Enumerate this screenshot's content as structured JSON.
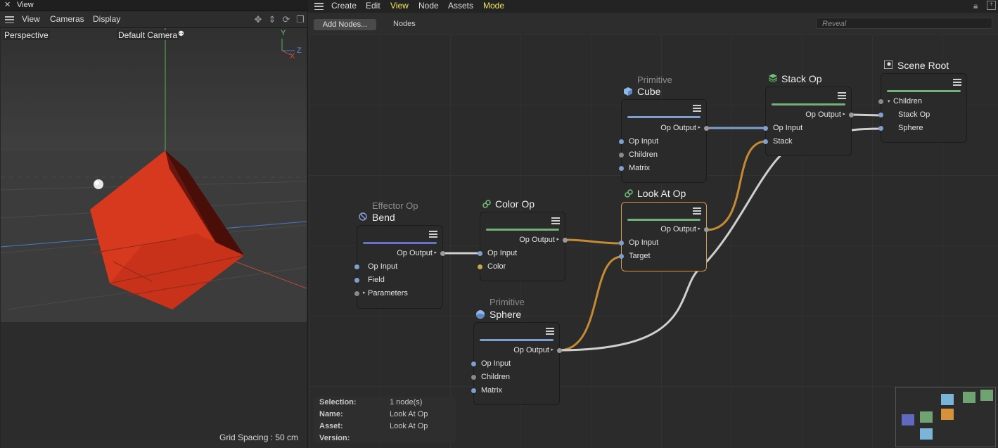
{
  "viewport": {
    "title": "View",
    "close_glyph": "✕",
    "menus": [
      "View",
      "Cameras",
      "Display"
    ],
    "projection": "Perspective",
    "camera": "Default Camera",
    "axis_y": "Y",
    "axis_z": "Z",
    "axis_x": "X",
    "grid_spacing": "Grid Spacing : 50 cm",
    "nav_icons": [
      "move-icon",
      "dolly-icon",
      "rotate-icon",
      "maximize-icon"
    ]
  },
  "editor": {
    "menus": [
      "Create",
      "Edit",
      "View",
      "Node",
      "Assets",
      "Mode"
    ],
    "active_menus": [
      "View",
      "Mode"
    ],
    "add_nodes": "Add Nodes...",
    "nodes_label": "Nodes",
    "reveal_placeholder": "Reveal",
    "nodes": {
      "cube": {
        "subtitle": "Primitive",
        "title": "Cube",
        "output": "Op Output",
        "inputs": [
          "Op Input",
          "Children",
          "Matrix"
        ]
      },
      "stack": {
        "title": "Stack Op",
        "output": "Op Output",
        "inputs": [
          "Op Input",
          "Stack"
        ]
      },
      "scene_root": {
        "title": "Scene Root",
        "inputs": [
          "Children",
          "Stack Op",
          "Sphere"
        ]
      },
      "bend": {
        "subtitle": "Effector Op",
        "title": "Bend",
        "output": "Op Output",
        "inputs": [
          "Op Input",
          "Field",
          "Parameters"
        ]
      },
      "color_op": {
        "title": "Color Op",
        "output": "Op Output",
        "inputs": [
          "Op Input",
          "Color"
        ]
      },
      "look_at": {
        "title": "Look At Op",
        "output": "Op Output",
        "inputs": [
          "Op Input",
          "Target"
        ]
      },
      "sphere": {
        "subtitle": "Primitive",
        "title": "Sphere",
        "output": "Op Output",
        "inputs": [
          "Op Input",
          "Children",
          "Matrix"
        ]
      }
    },
    "info": {
      "selection_label": "Selection:",
      "selection_value": "1 node(s)",
      "name_label": "Name:",
      "name_value": "Look At Op",
      "asset_label": "Asset:",
      "asset_value": "Look At Op",
      "version_label": "Version:",
      "version_value": ""
    },
    "colors": {
      "accent_yellow": "#f2e65a",
      "wire_orange": "#c58a34",
      "wire_white": "#cfcfcf",
      "wire_blue": "#7e9fd0",
      "cube_red": "#d8381f"
    }
  }
}
